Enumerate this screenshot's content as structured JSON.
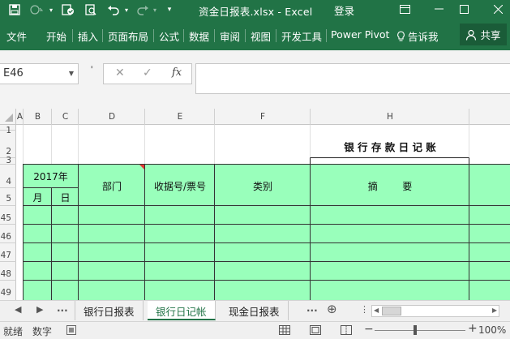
{
  "window": {
    "title": "资金日报表.xlsx  -  Excel",
    "login": "登录"
  },
  "ribbon": {
    "tabs": [
      "文件",
      "开始",
      "插入",
      "页面布局",
      "公式",
      "数据",
      "审阅",
      "视图",
      "开发工具",
      "Power Pivot"
    ],
    "tell_me": "告诉我",
    "share": "共享"
  },
  "formula_bar": {
    "name_box": "E46",
    "cancel_glyph": "✕",
    "enter_glyph": "✓",
    "fx_glyph": "fx",
    "value": ""
  },
  "grid": {
    "columns": [
      "A",
      "B",
      "C",
      "D",
      "E",
      "F",
      "H"
    ],
    "rows": [
      "1",
      "2",
      "3",
      "4",
      "5",
      "45",
      "46",
      "47",
      "48",
      "49"
    ],
    "sheet_title": "银 行 存 款 日 记 账",
    "headers": {
      "year": "2017年",
      "month": "月",
      "day": "日",
      "dept": "部门",
      "receipt": "收据号/票号",
      "category": "类别",
      "summary": "摘        要"
    },
    "header_fill": "#99ffbb",
    "comment_marker": "#e53935"
  },
  "sheets": {
    "tabs": [
      "银行日报表",
      "银行日记帐",
      "现金日报表"
    ],
    "active": 1,
    "more": "...",
    "add_glyph": "⊕"
  },
  "status": {
    "ready": "就绪",
    "mode": "数字",
    "zoom": "100%"
  },
  "theme": {
    "excel_green": "#217346"
  }
}
